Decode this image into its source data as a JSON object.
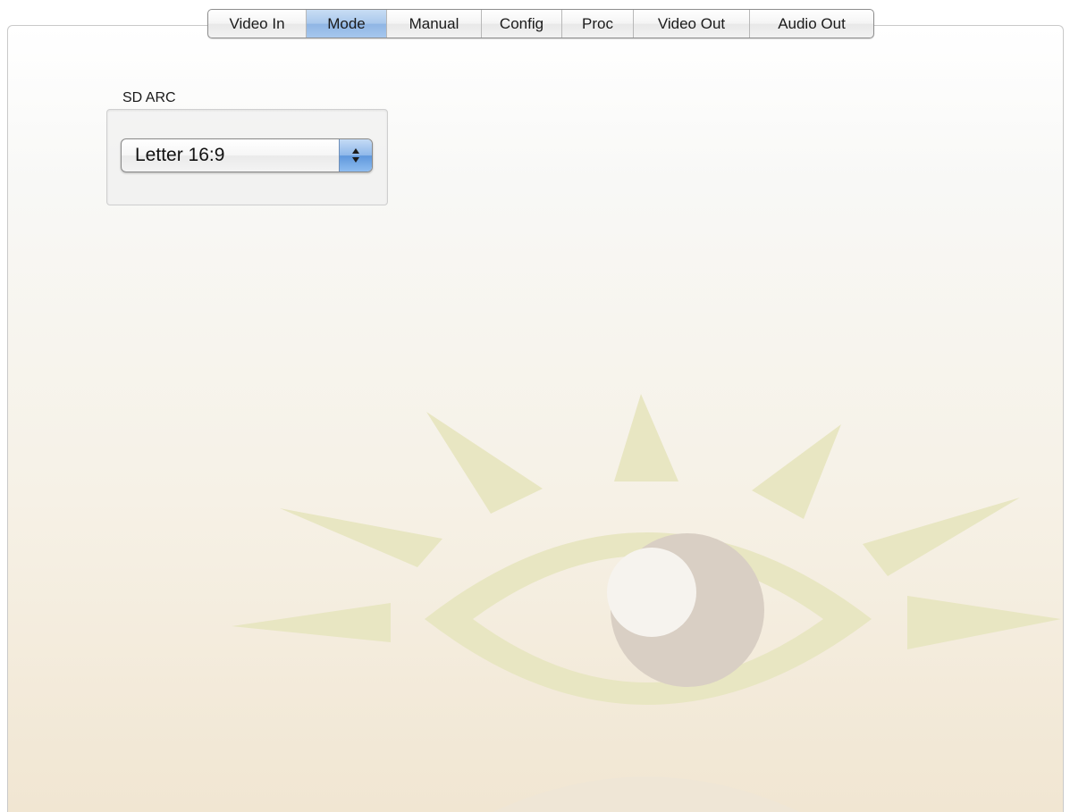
{
  "tabs": [
    {
      "label": "Video In",
      "active": false
    },
    {
      "label": "Mode",
      "active": true
    },
    {
      "label": "Manual",
      "active": false
    },
    {
      "label": "Config",
      "active": false
    },
    {
      "label": "Proc",
      "active": false
    },
    {
      "label": "Video Out",
      "active": false
    },
    {
      "label": "Audio Out",
      "active": false
    }
  ],
  "sd_arc": {
    "label": "SD ARC",
    "selected": "Letter 16:9"
  },
  "watermark": {
    "icon": "eye-logo-icon"
  },
  "colors": {
    "active_tab": "#a9c8ec",
    "watermark_rays": "#e8e6c2",
    "watermark_iris": "#d9cfc4"
  }
}
